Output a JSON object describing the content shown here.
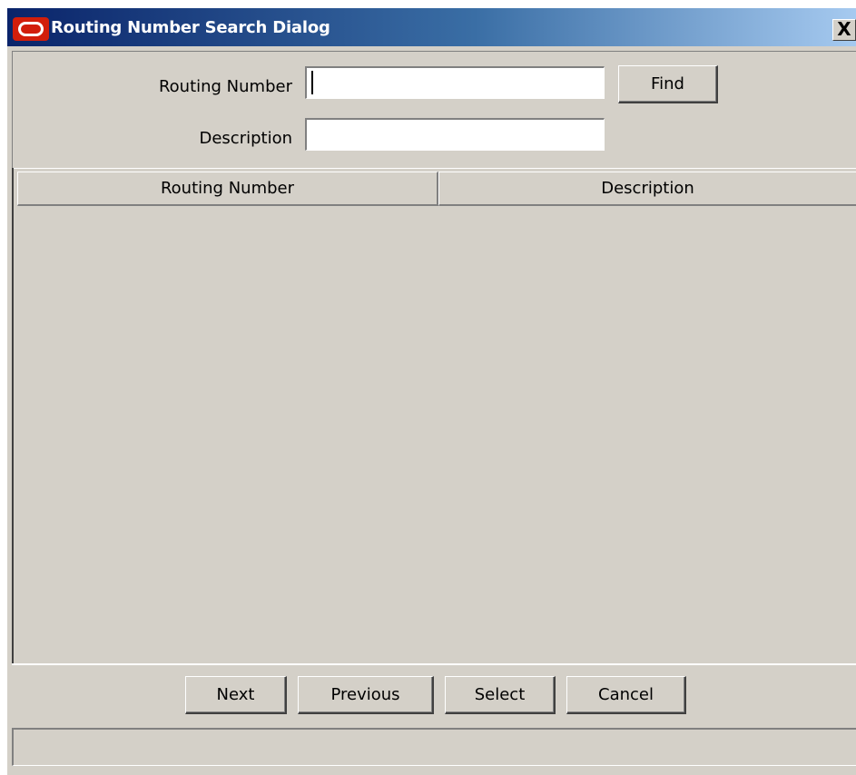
{
  "window": {
    "title": "Routing Number Search Dialog",
    "close_label": "X",
    "app_icon": "oracle-logo-icon"
  },
  "search": {
    "routing_number_label": "Routing Number",
    "routing_number_value": "",
    "description_label": "Description",
    "description_value": "",
    "find_label": "Find"
  },
  "results": {
    "columns": [
      "Routing Number",
      "Description"
    ],
    "rows": []
  },
  "buttons": {
    "next": "Next",
    "previous": "Previous",
    "select": "Select",
    "cancel": "Cancel"
  },
  "status": {
    "text": ""
  }
}
